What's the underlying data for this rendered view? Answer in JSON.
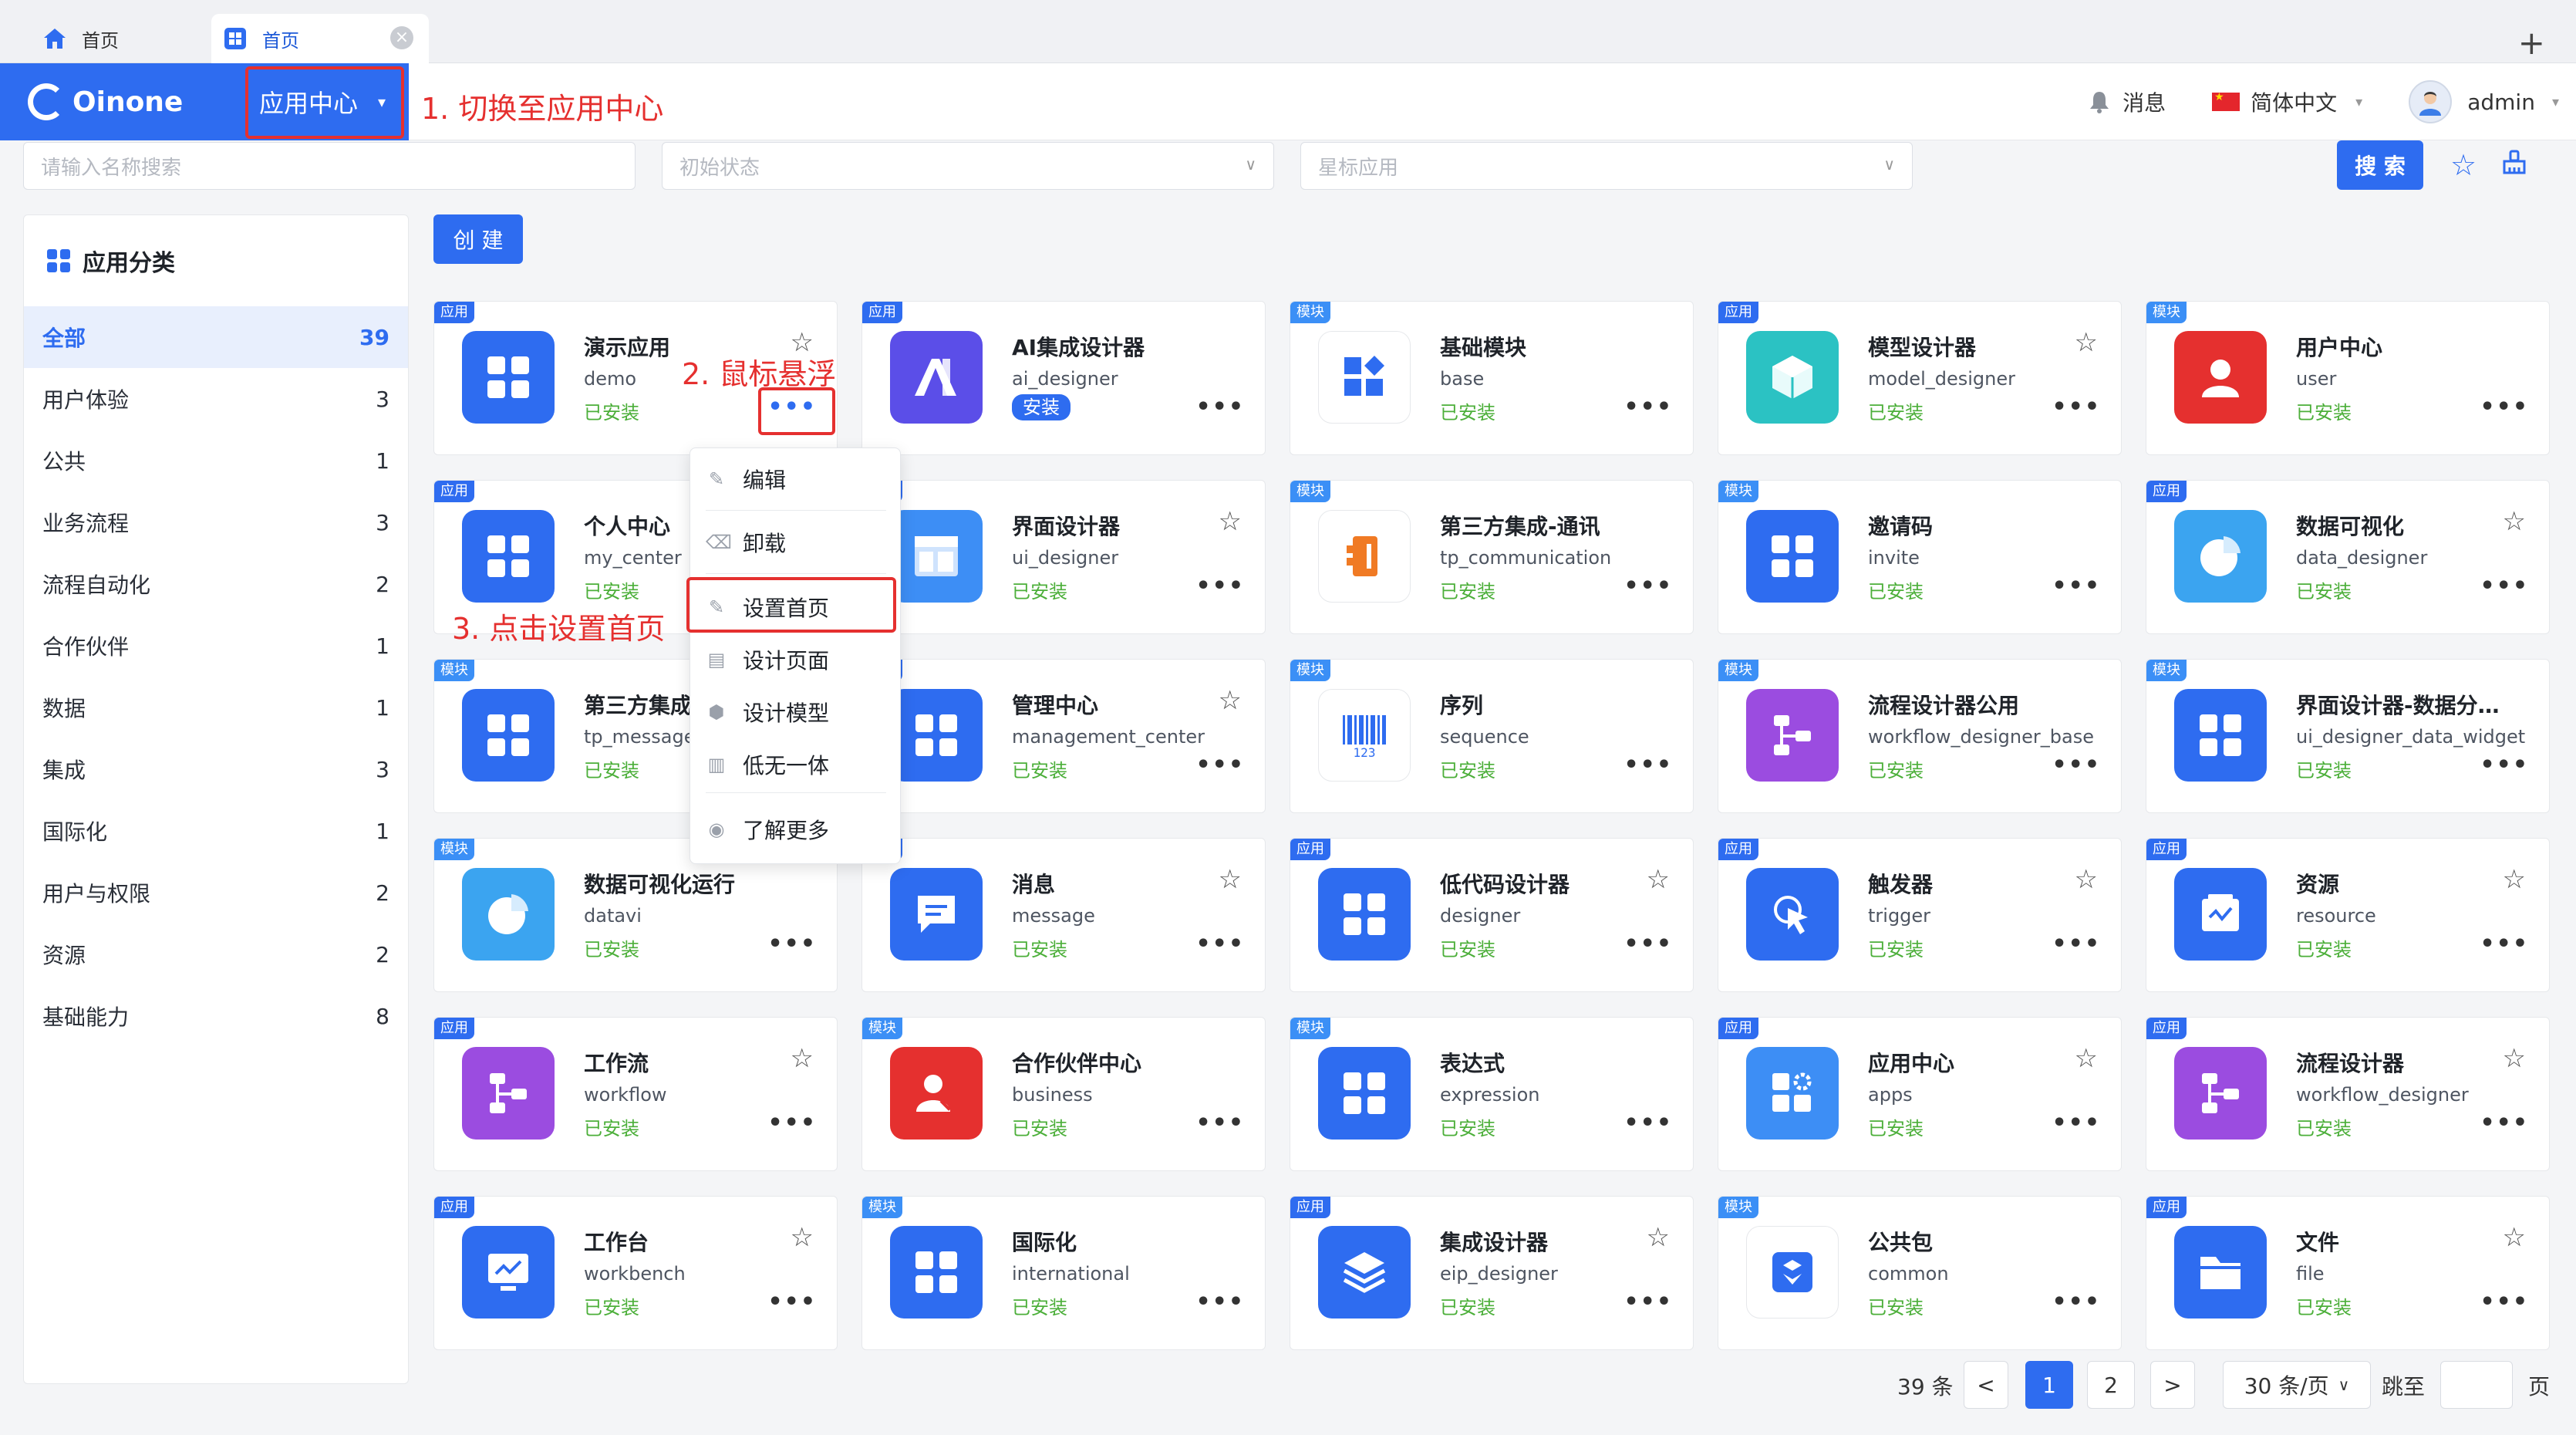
{
  "tabs": [
    {
      "label": "首页",
      "icon": "home-icon"
    },
    {
      "label": "首页",
      "icon": "app-grid-icon",
      "close": "×"
    }
  ],
  "tab_add": "+",
  "header": {
    "brand": "Oinone",
    "app_switch": "应用中心",
    "caret": "▾",
    "messages": "消息",
    "language": "简体中文",
    "user": "admin"
  },
  "annotations": {
    "step1": "1. 切换至应用中心",
    "step2": "2. 鼠标悬浮",
    "step3": "3. 点击设置首页"
  },
  "filters": {
    "name_placeholder": "请输入名称搜索",
    "status_placeholder": "初始状态",
    "star_placeholder": "星标应用",
    "search_label": "搜 索"
  },
  "sidebar": {
    "title": "应用分类",
    "items": [
      {
        "label": "全部",
        "count": "39"
      },
      {
        "label": "用户体验",
        "count": "3"
      },
      {
        "label": "公共",
        "count": "1"
      },
      {
        "label": "业务流程",
        "count": "3"
      },
      {
        "label": "流程自动化",
        "count": "2"
      },
      {
        "label": "合作伙伴",
        "count": "1"
      },
      {
        "label": "数据",
        "count": "1"
      },
      {
        "label": "集成",
        "count": "3"
      },
      {
        "label": "国际化",
        "count": "1"
      },
      {
        "label": "用户与权限",
        "count": "2"
      },
      {
        "label": "资源",
        "count": "2"
      },
      {
        "label": "基础能力",
        "count": "8"
      }
    ]
  },
  "create_label": "创 建",
  "cards": [
    {
      "tag": "应用",
      "name": "演示应用",
      "code": "demo",
      "status": "已安装",
      "star": true,
      "color": "#2e6cf0",
      "icon": "grid"
    },
    {
      "tag": "应用",
      "name": "AI集成设计器",
      "code": "ai_designer",
      "status": "安装",
      "star": false,
      "color": "#5b4ee8",
      "icon": "ai"
    },
    {
      "tag": "模块",
      "name": "基础模块",
      "code": "base",
      "status": "已安装",
      "star": false,
      "color": "#ffffff",
      "icon": "base"
    },
    {
      "tag": "应用",
      "name": "模型设计器",
      "code": "model_designer",
      "status": "已安装",
      "star": true,
      "color": "#2bc2c3",
      "icon": "cube"
    },
    {
      "tag": "模块",
      "name": "用户中心",
      "code": "user",
      "status": "已安装",
      "star": false,
      "color": "#e5302f",
      "icon": "user"
    },
    {
      "tag": "应用",
      "name": "个人中心",
      "code": "my_center",
      "status": "已安装",
      "star": false,
      "color": "#2e6cf0",
      "icon": "grid"
    },
    {
      "tag": "应用",
      "name": "界面设计器",
      "code": "ui_designer",
      "status": "已安装",
      "star": true,
      "color": "#3d8ef5",
      "icon": "layout"
    },
    {
      "tag": "模块",
      "name": "第三方集成-通讯",
      "code": "tp_communication",
      "status": "已安装",
      "star": false,
      "color": "#ffffff",
      "icon": "comm"
    },
    {
      "tag": "模块",
      "name": "邀请码",
      "code": "invite",
      "status": "已安装",
      "star": false,
      "color": "#2e6cf0",
      "icon": "grid"
    },
    {
      "tag": "应用",
      "name": "数据可视化",
      "code": "data_designer",
      "status": "已安装",
      "star": true,
      "color": "#3ba4f0",
      "icon": "pie"
    },
    {
      "tag": "模块",
      "name": "第三方集成",
      "code": "tp_message",
      "status": "已安装",
      "star": false,
      "color": "#2e6cf0",
      "icon": "grid"
    },
    {
      "tag": "应用",
      "name": "管理中心",
      "code": "management_center",
      "status": "已安装",
      "star": true,
      "color": "#2e6cf0",
      "icon": "grid"
    },
    {
      "tag": "模块",
      "name": "序列",
      "code": "sequence",
      "status": "已安装",
      "star": false,
      "color": "#ffffff",
      "icon": "barcode"
    },
    {
      "tag": "模块",
      "name": "流程设计器公用",
      "code": "workflow_designer_base",
      "status": "已安装",
      "star": false,
      "color": "#9b4ce0",
      "icon": "flow"
    },
    {
      "tag": "模块",
      "name": "界面设计器-数据分…",
      "code": "ui_designer_data_widget",
      "status": "已安装",
      "star": false,
      "color": "#2e6cf0",
      "icon": "grid"
    },
    {
      "tag": "模块",
      "name": "数据可视化运行",
      "code": "datavi",
      "status": "已安装",
      "star": false,
      "color": "#3ba4f0",
      "icon": "pie"
    },
    {
      "tag": "应用",
      "name": "消息",
      "code": "message",
      "status": "已安装",
      "star": true,
      "color": "#2e6cf0",
      "icon": "msg"
    },
    {
      "tag": "应用",
      "name": "低代码设计器",
      "code": "designer",
      "status": "已安装",
      "star": true,
      "color": "#2e6cf0",
      "icon": "grid"
    },
    {
      "tag": "应用",
      "name": "触发器",
      "code": "trigger",
      "status": "已安装",
      "star": true,
      "color": "#2e6cf0",
      "icon": "cursor"
    },
    {
      "tag": "应用",
      "name": "资源",
      "code": "resource",
      "status": "已安装",
      "star": true,
      "color": "#2e6cf0",
      "icon": "res"
    },
    {
      "tag": "应用",
      "name": "工作流",
      "code": "workflow",
      "status": "已安装",
      "star": true,
      "color": "#9b4ce0",
      "icon": "flow"
    },
    {
      "tag": "模块",
      "name": "合作伙伴中心",
      "code": "business",
      "status": "已安装",
      "star": false,
      "color": "#e5302f",
      "icon": "partner"
    },
    {
      "tag": "模块",
      "name": "表达式",
      "code": "expression",
      "status": "已安装",
      "star": false,
      "color": "#2e6cf0",
      "icon": "grid"
    },
    {
      "tag": "应用",
      "name": "应用中心",
      "code": "apps",
      "status": "已安装",
      "star": true,
      "color": "#3d8ef5",
      "icon": "appgear"
    },
    {
      "tag": "应用",
      "name": "流程设计器",
      "code": "workflow_designer",
      "status": "已安装",
      "star": true,
      "color": "#9b4ce0",
      "icon": "flow"
    },
    {
      "tag": "应用",
      "name": "工作台",
      "code": "workbench",
      "status": "已安装",
      "star": true,
      "color": "#2e6cf0",
      "icon": "monitor"
    },
    {
      "tag": "模块",
      "name": "国际化",
      "code": "international",
      "status": "已安装",
      "star": false,
      "color": "#2e6cf0",
      "icon": "grid"
    },
    {
      "tag": "应用",
      "name": "集成设计器",
      "code": "eip_designer",
      "status": "已安装",
      "star": true,
      "color": "#2e6cf0",
      "icon": "layers"
    },
    {
      "tag": "模块",
      "name": "公共包",
      "code": "common",
      "status": "已安装",
      "star": false,
      "color": "#ffffff",
      "icon": "box"
    },
    {
      "tag": "应用",
      "name": "文件",
      "code": "file",
      "status": "已安装",
      "star": true,
      "color": "#2e6cf0",
      "icon": "folder"
    }
  ],
  "context_menu": [
    {
      "label": "编辑",
      "icon": "brush-icon"
    },
    {
      "label": "卸载",
      "icon": "uninstall-icon"
    },
    {
      "label": "设置首页",
      "icon": "brush-icon"
    },
    {
      "label": "设计页面",
      "icon": "page-icon"
    },
    {
      "label": "设计模型",
      "icon": "cube-icon"
    },
    {
      "label": "低无一体",
      "icon": "doc-icon"
    },
    {
      "label": "了解更多",
      "icon": "more-circle-icon"
    }
  ],
  "pagination": {
    "total": "39 条",
    "prev": "<",
    "pages": [
      "1",
      "2"
    ],
    "next": ">",
    "page_size": "30 条/页",
    "jump_label": "跳至",
    "page_unit": "页"
  }
}
